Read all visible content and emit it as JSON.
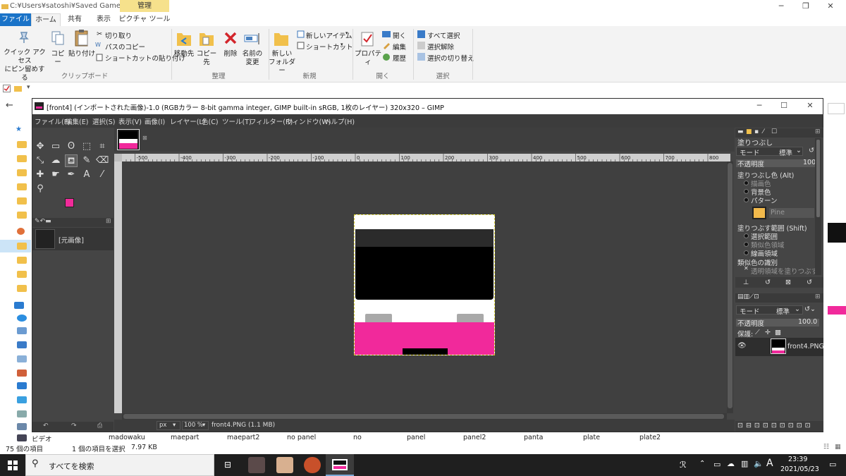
{
  "explorer": {
    "title_path": "C:¥Users¥satoshi¥Saved Games¥Rai...",
    "context_tab": "管理",
    "tabs": [
      "ファイル",
      "ホーム",
      "共有",
      "表示",
      "ピクチャ ツール"
    ],
    "ribbon": {
      "pin_label": "クイック アクセス\nにピン留めする",
      "copy": "コピー",
      "paste": "貼り付け",
      "cut": "切り取り",
      "copy_path": "パスのコピー",
      "paste_shortcut": "ショートカットの貼り付け",
      "group_clipboard": "クリップボード",
      "move_to": "移動先",
      "copy_to": "コピー先",
      "delete": "削除",
      "rename": "名前の\n変更",
      "group_organize": "整理",
      "new_folder": "新しい\nフォルダー",
      "new_item": "新しいアイテム",
      "shortcut": "ショートカット",
      "group_new": "新規",
      "properties": "プロパティ",
      "open": "開く",
      "edit": "編集",
      "history": "履歴",
      "group_open": "開く",
      "select_all": "すべて選択",
      "select_none": "選択解除",
      "invert_selection": "選択の切り替え",
      "group_select": "選択"
    },
    "nav_video": "ビデオ",
    "file_names": [
      "madowaku",
      "maepart",
      "maepart2",
      "no panel",
      "no",
      "panel",
      "panel2",
      "panta",
      "plate",
      "plate2"
    ],
    "status_count": "75 個の項目",
    "status_selected": "1 個の項目を選択",
    "status_size": "7.97 KB"
  },
  "gimp": {
    "title": "[front4] (インポートされた画像)-1.0 (RGBカラー 8-bit gamma integer, GIMP built-in sRGB, 1枚のレイヤー) 320x320 – GIMP",
    "menu": [
      "ファイル(F)",
      "編集(E)",
      "選択(S)",
      "表示(V)",
      "画像(I)",
      "レイヤー(L)",
      "色(C)",
      "ツール(T)",
      "フィルター(R)",
      "ウィンドウ(W)",
      "ヘルプ(H)"
    ],
    "ruler_labels": [
      "-500",
      "-400",
      "-300",
      "-200",
      "-100",
      "0",
      "100",
      "200",
      "300",
      "400",
      "500",
      "600",
      "700",
      "800"
    ],
    "images_panel_item": "[元画像]",
    "status_unit": "px",
    "status_zoom": "100 %",
    "status_file": "front4.PNG (1.1 MB)",
    "tool_options": {
      "title": "塗りつぶし",
      "mode_label": "モード",
      "mode_value": "標準",
      "opacity_label": "不透明度",
      "opacity_value": "100",
      "fill_type_label": "塗りつぶし色 (Alt)",
      "opt_fg": "描画色",
      "opt_bg": "背景色",
      "opt_pattern": "パターン",
      "pattern_name": "Pine",
      "fill_area_label": "塗りつぶす範囲 (Shift)",
      "opt_selection": "選択範囲",
      "opt_similar": "類似色領域",
      "opt_line": "線画領域",
      "similar_label": "類似色の識別",
      "transparent_label": "透明領域を塗りつぶす"
    },
    "layers": {
      "mode_label": "モード",
      "mode_value": "標準",
      "opacity_label": "不透明度",
      "opacity_value": "100.0",
      "lock_label": "保護:",
      "layer_name": "front4.PNG"
    },
    "colors": {
      "fg": "#f12b9a",
      "bg": "#ffffff",
      "image_pink": "#f1299b",
      "image_black": "#000000",
      "image_gray": "#a9a9a9"
    }
  },
  "taskbar": {
    "search_placeholder": "すべてを検索",
    "ime": "A",
    "time": "23:39",
    "date": "2021/05/23"
  }
}
